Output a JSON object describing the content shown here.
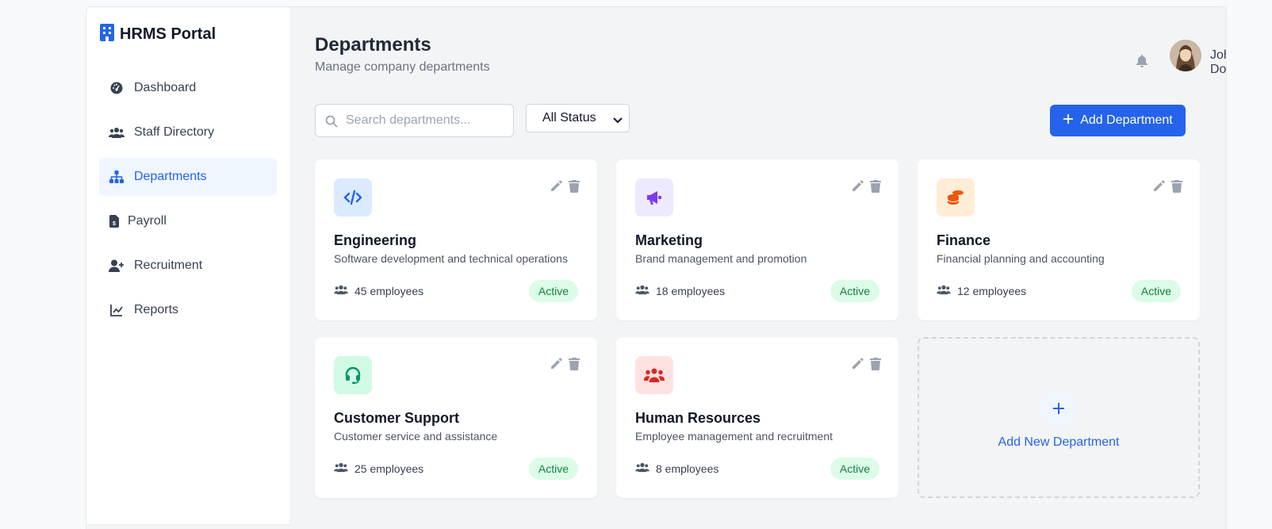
{
  "brand": {
    "title": "HRMS Portal",
    "icon": "building-icon"
  },
  "sidebar": {
    "items": [
      {
        "label": "Dashboard",
        "icon": "gauge-icon",
        "active": false
      },
      {
        "label": "Staff Directory",
        "icon": "users-icon",
        "active": false
      },
      {
        "label": "Departments",
        "icon": "sitemap-icon",
        "active": true
      },
      {
        "label": "Payroll",
        "icon": "invoice-dollar-icon",
        "active": false
      },
      {
        "label": "Recruitment",
        "icon": "user-plus-icon",
        "active": false
      },
      {
        "label": "Reports",
        "icon": "chart-line-icon",
        "active": false
      }
    ]
  },
  "header": {
    "title": "Departments",
    "subtitle": "Manage company departments",
    "user_name": "John Doe"
  },
  "toolbar": {
    "search_placeholder": "Search departments...",
    "status_value": "All Status",
    "add_label": "Add Department"
  },
  "departments": [
    {
      "name": "Engineering",
      "description": "Software development and technical operations",
      "employees": "45 employees",
      "status": "Active",
      "icon": "code-icon",
      "icon_color": "#2563eb",
      "icon_bg": "#dbeafe"
    },
    {
      "name": "Marketing",
      "description": "Brand management and promotion",
      "employees": "18 employees",
      "status": "Active",
      "icon": "megaphone-icon",
      "icon_color": "#7c3aed",
      "icon_bg": "#ede9fe"
    },
    {
      "name": "Finance",
      "description": "Financial planning and accounting",
      "employees": "12 employees",
      "status": "Active",
      "icon": "coins-icon",
      "icon_color": "#ea580c",
      "icon_bg": "#ffedd5"
    },
    {
      "name": "Customer Support",
      "description": "Customer service and assistance",
      "employees": "25 employees",
      "status": "Active",
      "icon": "headset-icon",
      "icon_color": "#059669",
      "icon_bg": "#d1fae5"
    },
    {
      "name": "Human Resources",
      "description": "Employee management and recruitment",
      "employees": "8 employees",
      "status": "Active",
      "icon": "people-group-icon",
      "icon_color": "#dc2626",
      "icon_bg": "#fee2e2"
    }
  ],
  "add_card": {
    "label": "Add New Department"
  },
  "colors": {
    "accent": "#2563eb",
    "active_bg": "#eff6ff",
    "badge_bg": "#dcfce7",
    "badge_text": "#15803d"
  }
}
